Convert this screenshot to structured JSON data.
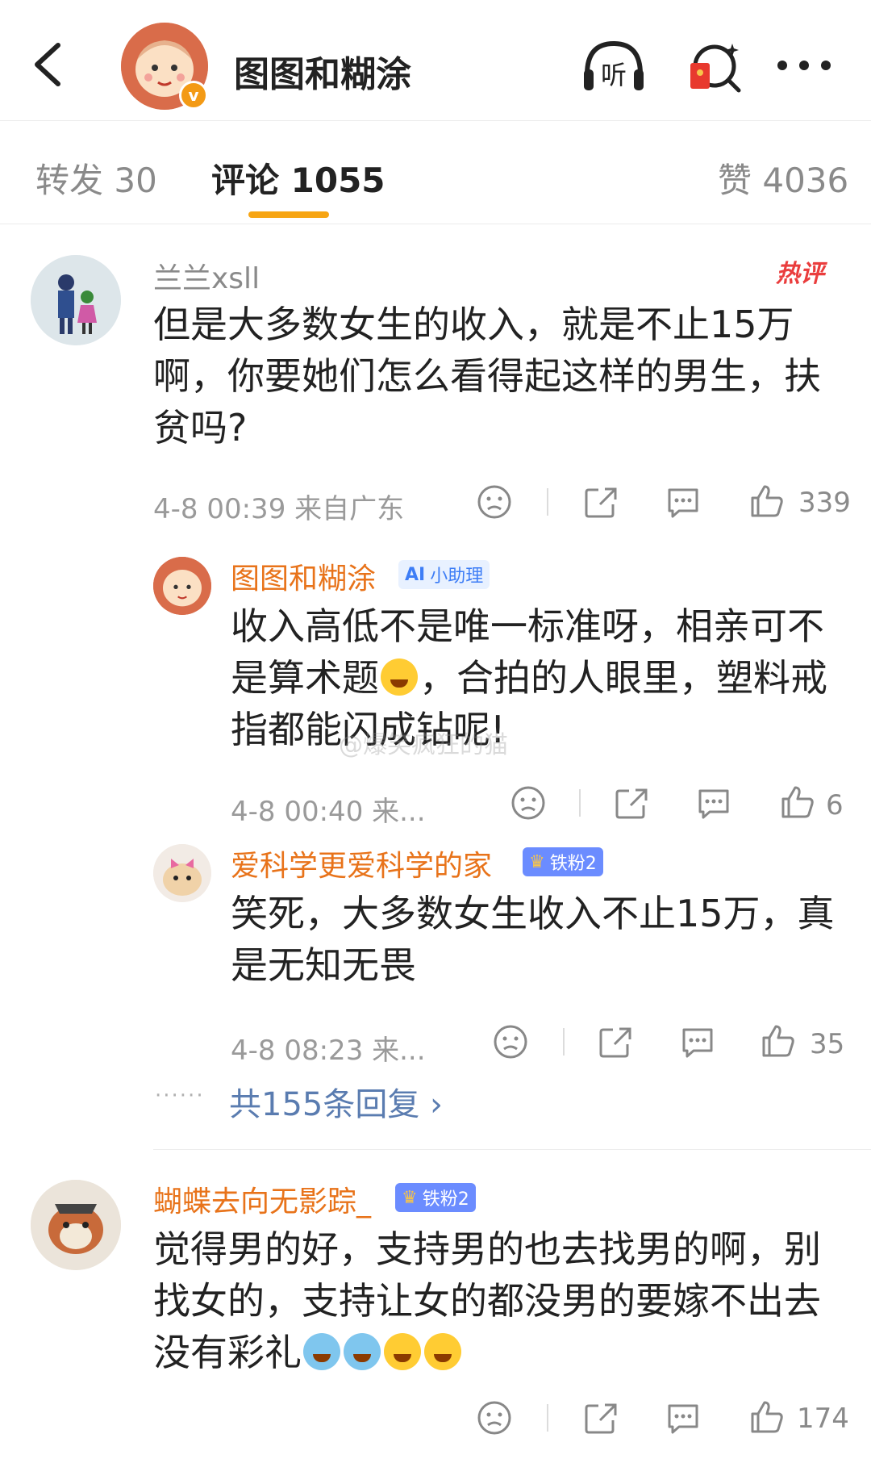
{
  "header": {
    "title": "图图和糊涂",
    "listen_label": "听"
  },
  "tabs": [
    {
      "label": "转发 30"
    },
    {
      "label": "评论 1055"
    },
    {
      "label": "赞 4036"
    }
  ],
  "comments": [
    {
      "username": "兰兰xsll",
      "hot_label": "热评",
      "text": "但是大多数女生的收入，就是不止15万啊，你要她们怎么看得起这样的男生，扶贫吗?",
      "meta": "4-8 00:39  来自广东",
      "likes": "339"
    },
    {
      "username": "图图和糊涂",
      "badge": "小助理",
      "badge_icon": "AI",
      "text": "收入高低不是唯一标准呀，相亲可不是算术题",
      "text_after": "，合拍的人眼里，塑料戒指都能闪成钻呢!",
      "meta": "4-8 00:40  来...",
      "likes": "6"
    },
    {
      "username": "爱科学更爱科学的家",
      "badge": "铁粉2",
      "text": "笑死，大多数女生收入不止15万，真是无知无畏",
      "meta": "4-8 08:23  来...",
      "likes": "35"
    },
    {
      "username": "蝴蝶去向无影踪_",
      "badge": "铁粉2",
      "text": "觉得男的好，支持男的也去找男的啊，别找女的，支持让女的都没男的要嫁不出去没有彩礼",
      "meta": "",
      "likes": "174"
    }
  ],
  "replies_link": "共155条回复 ›",
  "watermark": "@爆笑疯狂的猫",
  "colors": {
    "accent": "#f7a513",
    "username_orange": "#e8731a",
    "link_blue": "#5a7cb0",
    "hot_red": "#ea3d3d"
  }
}
